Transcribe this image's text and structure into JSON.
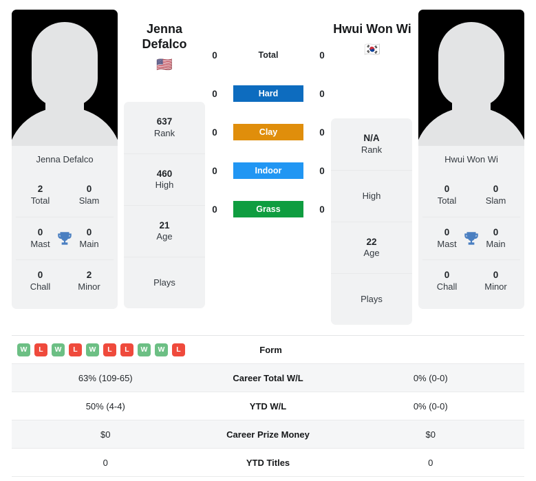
{
  "players": {
    "left": {
      "name_line1": "Jenna",
      "name_line2": "Defalco",
      "flag": "🇺🇸",
      "photo_caption": "Jenna Defalco",
      "titles": [
        {
          "value": "2",
          "label": "Total"
        },
        {
          "value": "0",
          "label": "Slam"
        },
        {
          "value": "0",
          "label": "Mast"
        },
        {
          "value": "0",
          "label": "Main"
        },
        {
          "value": "0",
          "label": "Chall"
        },
        {
          "value": "2",
          "label": "Minor"
        }
      ],
      "ranking": [
        {
          "value": "637",
          "label": "Rank"
        },
        {
          "value": "460",
          "label": "High"
        },
        {
          "value": "21",
          "label": "Age"
        },
        {
          "value": "",
          "label": "Plays"
        }
      ]
    },
    "right": {
      "name_line1": "Hwui Won Wi",
      "name_line2": "",
      "flag": "🇰🇷",
      "photo_caption": "Hwui Won Wi",
      "titles": [
        {
          "value": "0",
          "label": "Total"
        },
        {
          "value": "0",
          "label": "Slam"
        },
        {
          "value": "0",
          "label": "Mast"
        },
        {
          "value": "0",
          "label": "Main"
        },
        {
          "value": "0",
          "label": "Chall"
        },
        {
          "value": "0",
          "label": "Minor"
        }
      ],
      "ranking": [
        {
          "value": "N/A",
          "label": "Rank"
        },
        {
          "value": "",
          "label": "High"
        },
        {
          "value": "22",
          "label": "Age"
        },
        {
          "value": "",
          "label": "Plays"
        }
      ]
    }
  },
  "surfaces": [
    {
      "label": "Total",
      "left_score": "0",
      "right_score": "0",
      "color": "transparent",
      "plain": true
    },
    {
      "label": "Hard",
      "left_score": "0",
      "right_score": "0",
      "color": "#0d6cbf",
      "plain": false
    },
    {
      "label": "Clay",
      "left_score": "0",
      "right_score": "0",
      "color": "#e08e0b",
      "plain": false
    },
    {
      "label": "Indoor",
      "left_score": "0",
      "right_score": "0",
      "color": "#2196f3",
      "plain": false
    },
    {
      "label": "Grass",
      "left_score": "0",
      "right_score": "0",
      "color": "#0f9d40",
      "plain": false
    }
  ],
  "colors": {
    "hard": "#0d6cbf",
    "clay": "#e08e0b",
    "indoor": "#2196f3",
    "grass": "#0f9d40",
    "win": "#6cbf84",
    "loss": "#ef4a3c",
    "trophy": "#4a7fc1",
    "card_bg": "#f1f2f3"
  },
  "table": {
    "form_row": {
      "label": "Form",
      "left_form": [
        "W",
        "L",
        "W",
        "L",
        "W",
        "L",
        "L",
        "W",
        "W",
        "L"
      ],
      "right_value": ""
    },
    "rows": [
      {
        "left": "63% (109-65)",
        "label": "Career Total W/L",
        "right": "0% (0-0)"
      },
      {
        "left": "50% (4-4)",
        "label": "YTD W/L",
        "right": "0% (0-0)"
      },
      {
        "left": "$0",
        "label": "Career Prize Money",
        "right": "$0"
      },
      {
        "left": "0",
        "label": "YTD Titles",
        "right": "0"
      }
    ]
  }
}
